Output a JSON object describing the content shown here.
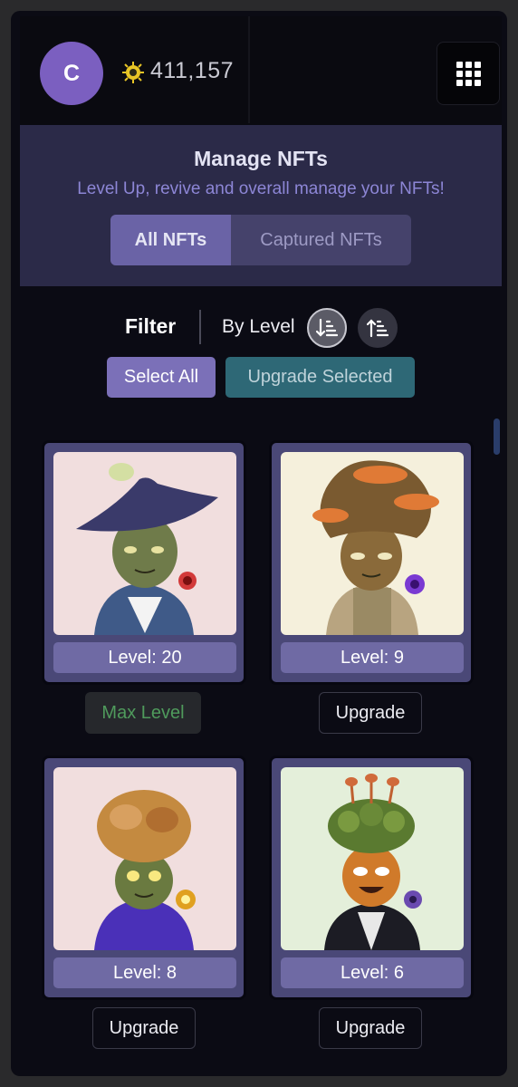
{
  "header": {
    "avatar_letter": "C",
    "coin_icon": "gold-token-icon",
    "balance": "411,157",
    "menu_icon": "grid-menu-icon"
  },
  "manage": {
    "title": "Manage NFTs",
    "subtitle": "Level Up, revive and overall manage your NFTs!",
    "tabs": [
      {
        "label": "All NFTs",
        "active": true
      },
      {
        "label": "Captured NFTs",
        "active": false
      }
    ]
  },
  "filter": {
    "label": "Filter",
    "sort_label": "By Level",
    "sort_desc_icon": "sort-descending-icon",
    "sort_asc_icon": "sort-ascending-icon",
    "select_all": "Select All",
    "upgrade_selected": "Upgrade Selected"
  },
  "cards": [
    {
      "level": "Level: 20",
      "action": "Max Level",
      "bg": "#f1dede",
      "element_color": "#d23a3a"
    },
    {
      "level": "Level: 9",
      "action": "Upgrade",
      "bg": "#f5f0dc",
      "element_color": "#7a3ad2"
    },
    {
      "level": "Level: 8",
      "action": "Upgrade",
      "bg": "#f1dede",
      "element_color": "#e0a020"
    },
    {
      "level": "Level: 6",
      "action": "Upgrade",
      "bg": "#e4efda",
      "element_color": "#6a4ab0"
    }
  ],
  "colors": {
    "accent": "#7b70b8",
    "teal": "#2e6876",
    "max_level_text": "#4f9a5c"
  }
}
